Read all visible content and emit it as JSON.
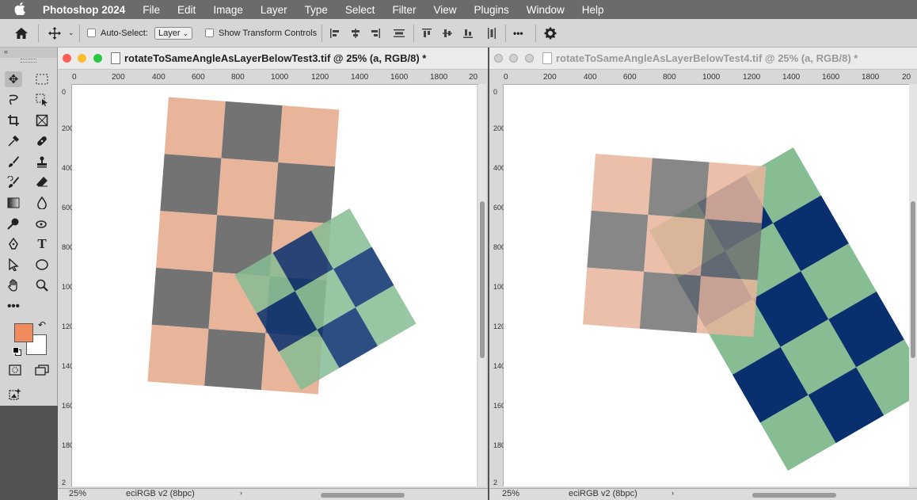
{
  "menu": {
    "app": "Photoshop 2024",
    "items": [
      "File",
      "Edit",
      "Image",
      "Layer",
      "Type",
      "Select",
      "Filter",
      "View",
      "Plugins",
      "Window",
      "Help"
    ]
  },
  "options": {
    "auto_select_label": "Auto-Select:",
    "auto_select_value": "Layer",
    "show_transform_label": "Show Transform Controls",
    "more": "•••"
  },
  "docs": [
    {
      "title": "rotateToSameAngleAsLayerBelowTest3.tif @ 25% (a, RGB/8) *",
      "zoom": "25%",
      "profile": "eciRGB v2 (8bpc)",
      "ruler_h": [
        "0",
        "200",
        "400",
        "600",
        "800",
        "1000",
        "1200",
        "1400",
        "1600",
        "1800",
        "20"
      ],
      "ruler_v": [
        "0",
        "200",
        "400",
        "600",
        "800",
        "1000",
        "1200",
        "1400",
        "1600",
        "1800",
        "2"
      ]
    },
    {
      "title": "rotateToSameAngleAsLayerBelowTest4.tif @ 25% (a, RGB/8) *",
      "zoom": "25%",
      "profile": "eciRGB v2 (8bpc)",
      "ruler_h": [
        "0",
        "200",
        "400",
        "600",
        "800",
        "1000",
        "1200",
        "1400",
        "1600",
        "1800",
        "20"
      ],
      "ruler_v": [
        "0",
        "200",
        "400",
        "600",
        "800",
        "1000",
        "1200",
        "1400",
        "1600",
        "1800",
        "2"
      ]
    }
  ],
  "colors": {
    "salmon": "#e8b59b",
    "gray": "#737373",
    "green": "#86bd93",
    "navy": "#08306e",
    "foreground": "#f08b5c",
    "background": "#ffffff"
  }
}
